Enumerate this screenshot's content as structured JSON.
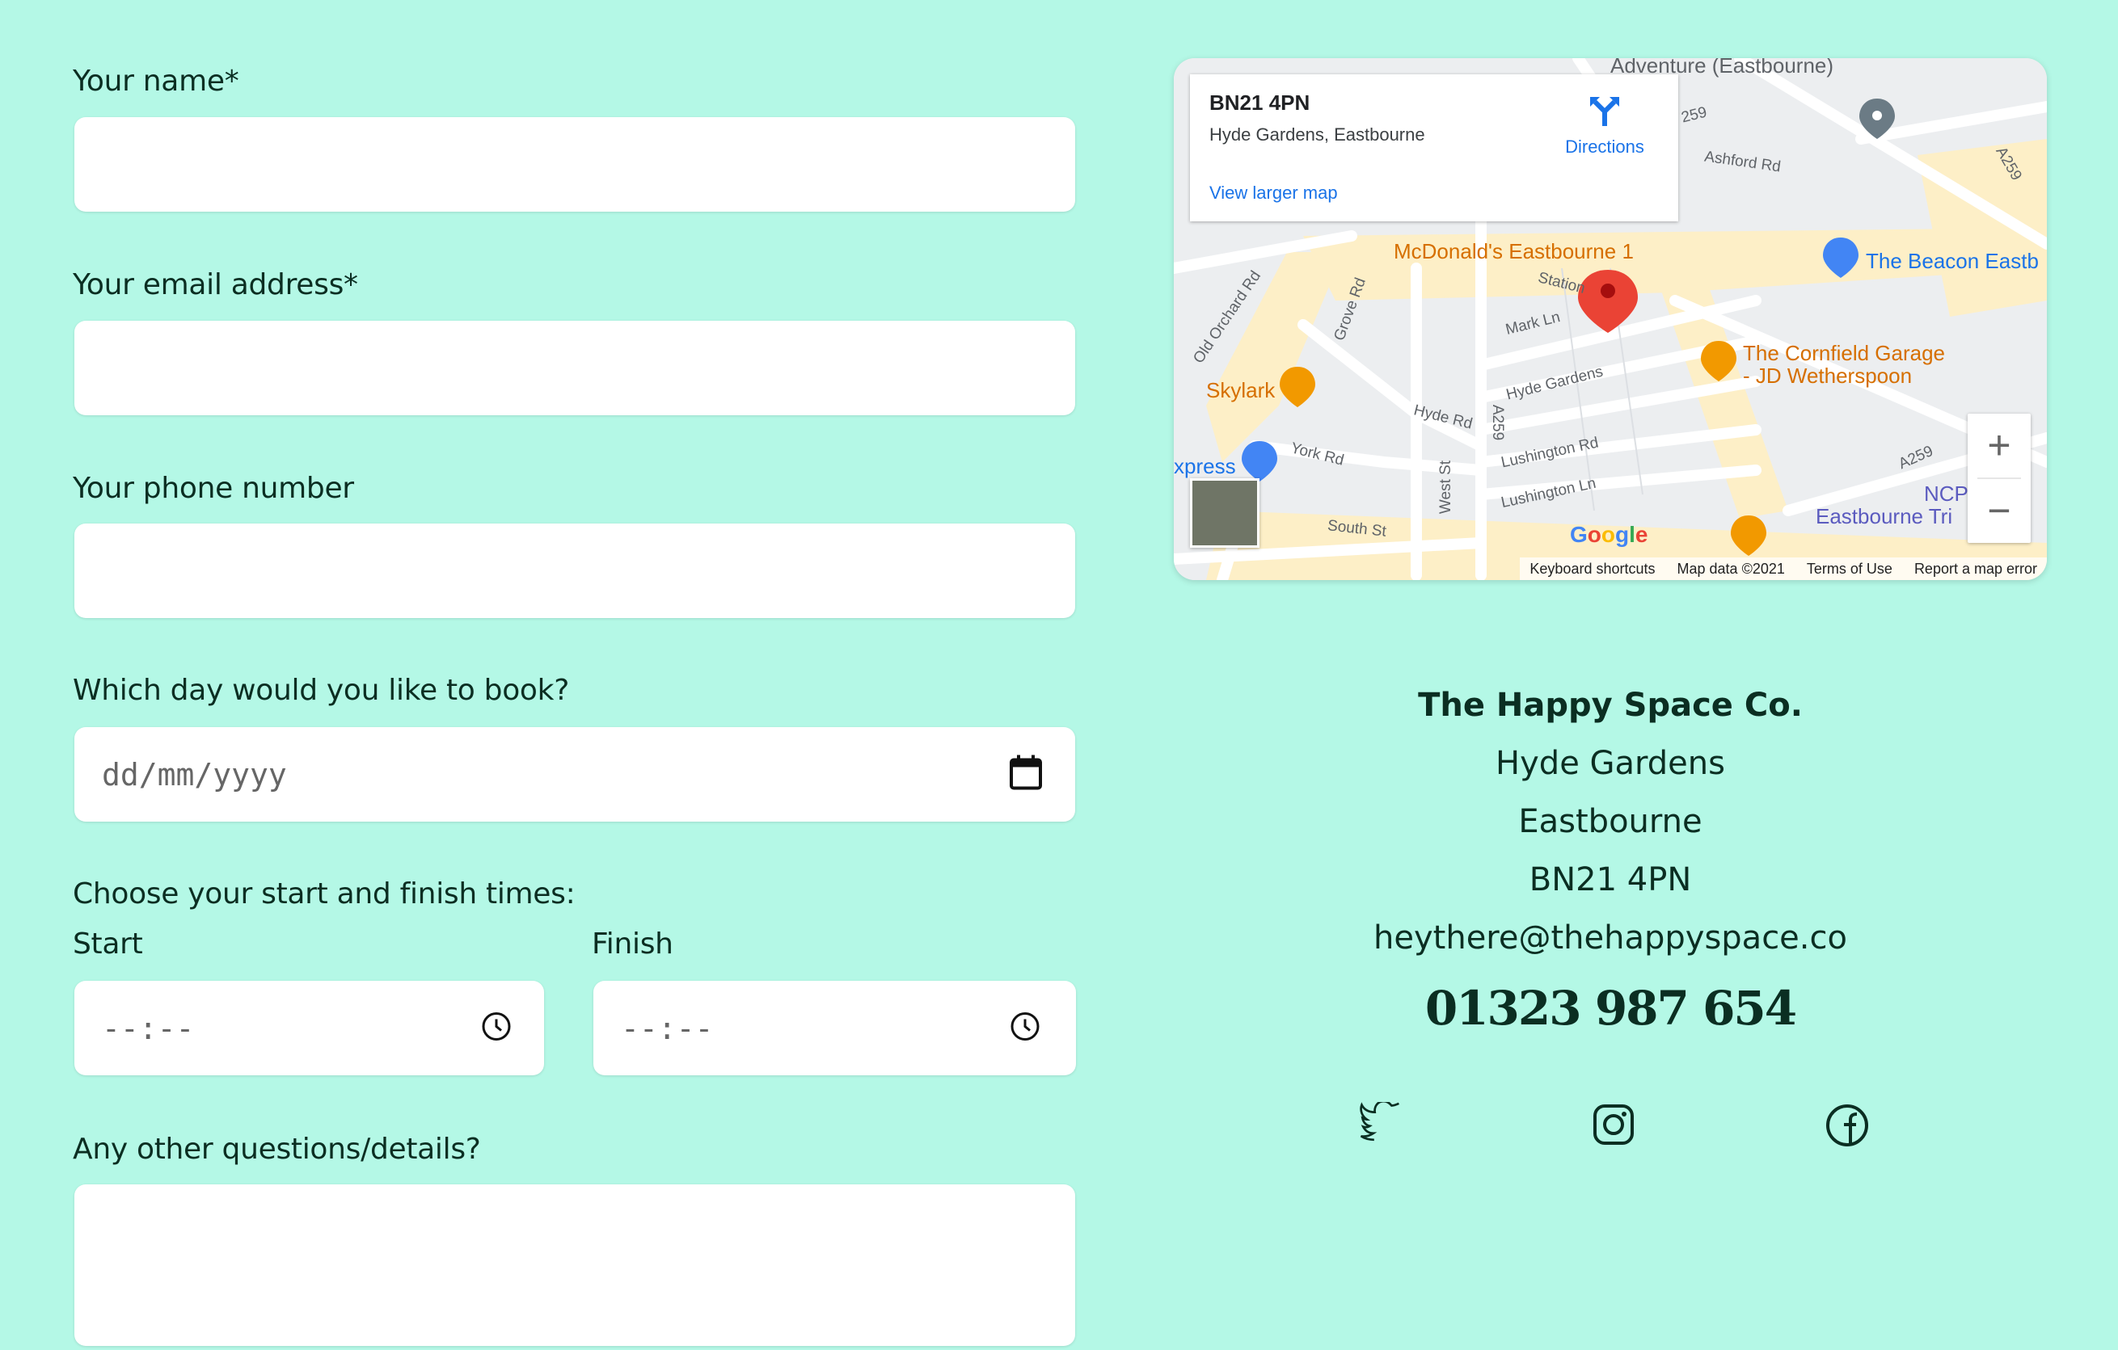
{
  "form": {
    "name_label": "Your name*",
    "email_label": "Your email address*",
    "phone_label": "Your phone number",
    "day_label": "Which day would you like to book?",
    "day_placeholder": "dd/mm/yyyy",
    "times_label": "Choose your start and finish times:",
    "start_label": "Start",
    "finish_label": "Finish",
    "time_placeholder": "--:--",
    "questions_label": "Any other questions/details?"
  },
  "map": {
    "card_title": "BN21 4PN",
    "card_address": "Hyde Gardens, Eastbourne",
    "directions": "Directions",
    "larger_map": "View larger map",
    "pois": {
      "adventure": "Adventure (Eastbourne)",
      "mcdonalds": "McDonald's Eastbourne 1",
      "beacon": "The Beacon Eastb",
      "cornfield_1": "The Cornfield Garage",
      "cornfield_2": "- JD Wetherspoon",
      "skylark": "Skylark",
      "express": "xpress",
      "ncp": "NCP",
      "eastbourne_tri": "Eastbourne Tri"
    },
    "streets": {
      "ashford": "Ashford Rd",
      "a259_top": "A259",
      "a259_top_left": "259",
      "a259_mid": "A259",
      "a259_right": "A259",
      "old_orchard": "Old Orchard Rd",
      "grove": "Grove Rd",
      "station": "Station",
      "mark": "Mark Ln",
      "hyde_gardens": "Hyde Gardens",
      "hyde_rd": "Hyde Rd",
      "york": "York Rd",
      "lushington_rd": "Lushington Rd",
      "lushington_ln": "Lushington Ln",
      "west_st": "West St",
      "south_st": "South St"
    },
    "footer": {
      "shortcuts": "Keyboard shortcuts",
      "data": "Map data ©2021",
      "terms": "Terms of Use",
      "report": "Report a map error"
    },
    "google": "Google",
    "zoom_in": "+",
    "zoom_out": "−"
  },
  "contact": {
    "company": "The Happy Space Co.",
    "line1": "Hyde Gardens",
    "line2": "Eastbourne",
    "postcode": "BN21 4PN",
    "email": "heythere@thehappyspace.co",
    "phone": "01323 987 654"
  },
  "social": {
    "icons": [
      "twitter-icon",
      "instagram-icon",
      "facebook-icon"
    ]
  },
  "colors": {
    "background": "#b4f8e6",
    "text": "#0b2e22",
    "link": "#1a73e8",
    "poi_orange": "#d66f00",
    "poi_blue": "#1a73e8",
    "pin_red": "#ea4335"
  }
}
